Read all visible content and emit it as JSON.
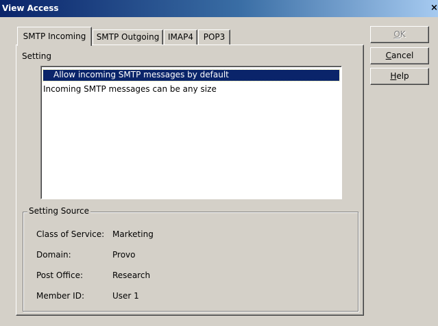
{
  "window": {
    "title": "View Access",
    "close_glyph": "×"
  },
  "tabs": [
    {
      "label": "SMTP Incoming",
      "active": true
    },
    {
      "label": "SMTP Outgoing",
      "active": false
    },
    {
      "label": "IMAP4",
      "active": false
    },
    {
      "label": "POP3",
      "active": false
    }
  ],
  "setting": {
    "label": "Setting",
    "items": [
      {
        "text": "Allow incoming SMTP messages by default",
        "selected": true
      },
      {
        "text": "Incoming SMTP messages can be any size",
        "selected": false
      }
    ]
  },
  "setting_source": {
    "legend": "Setting Source",
    "rows": [
      {
        "label": "Class of Service:",
        "value": "Marketing"
      },
      {
        "label": "Domain:",
        "value": "Provo"
      },
      {
        "label": "Post Office:",
        "value": "Research"
      },
      {
        "label": "Member ID:",
        "value": "User 1"
      }
    ]
  },
  "buttons": {
    "ok": {
      "mnemonic": "O",
      "rest": "K",
      "enabled": false
    },
    "cancel": {
      "mnemonic": "C",
      "rest": "ancel",
      "enabled": true
    },
    "help": {
      "mnemonic": "H",
      "rest": "elp",
      "enabled": true
    }
  }
}
